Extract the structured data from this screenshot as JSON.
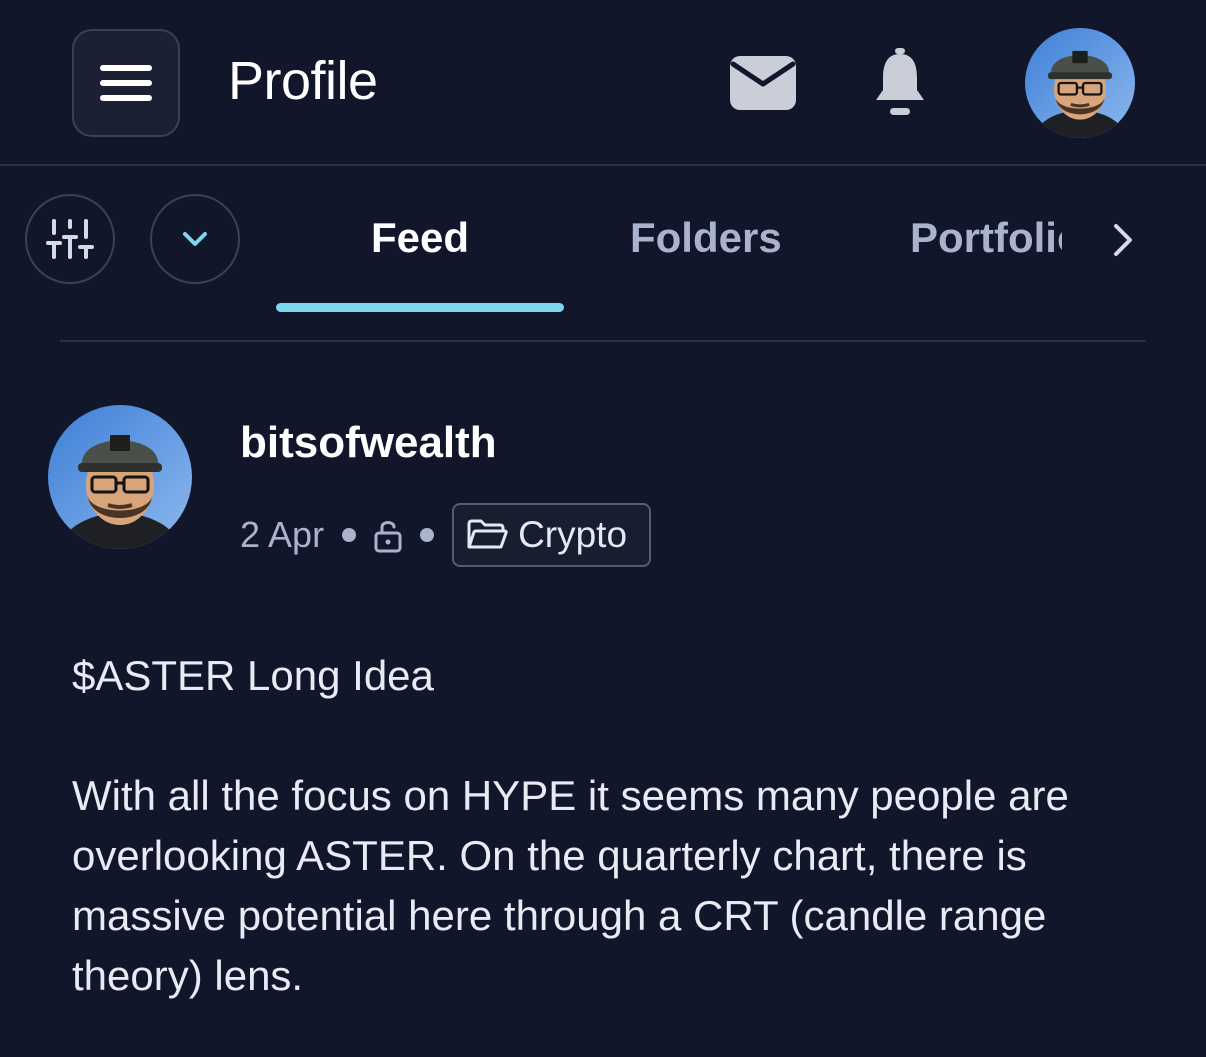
{
  "header": {
    "title": "Profile",
    "menu_icon": "hamburger-menu-icon",
    "mail_icon": "envelope-icon",
    "bell_icon": "bell-icon"
  },
  "tabs": [
    {
      "label": "Feed",
      "active": true
    },
    {
      "label": "Folders",
      "active": false
    },
    {
      "label": "Portfolio",
      "active": false
    }
  ],
  "post": {
    "author": "bitsofwealth",
    "date": "2 Apr",
    "folder": "Crypto",
    "title": "$ASTER Long Idea",
    "body": "With all the focus on HYPE it seems many people are overlooking ASTER. On the quarterly chart, there is massive potential here through a CRT (candle range theory) lens."
  },
  "colors": {
    "background": "#12162a",
    "accent": "#7ed6ee",
    "muted_text": "#aab3cc",
    "border": "#3a4055"
  }
}
